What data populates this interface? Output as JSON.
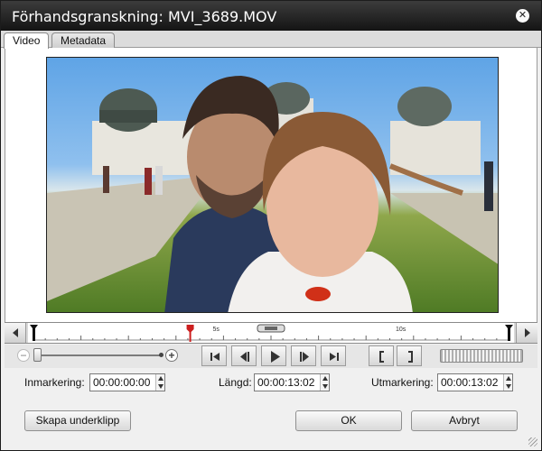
{
  "window": {
    "title": "Förhandsgranskning: MVI_3689.MOV"
  },
  "tabs": [
    {
      "label": "Video",
      "active": true
    },
    {
      "label": "Metadata",
      "active": false
    }
  ],
  "timeline": {
    "ticks": [
      "5s",
      "10s"
    ],
    "playhead_fraction": 0.33
  },
  "zoom": {
    "level_fraction": 0.0
  },
  "fields": {
    "in": {
      "label": "Inmarkering:",
      "value": "00:00:00:00"
    },
    "length": {
      "label": "Längd:",
      "value": "00:00:13:02"
    },
    "out": {
      "label": "Utmarkering:",
      "value": "00:00:13:02"
    }
  },
  "buttons": {
    "create_subclip": "Skapa underklipp",
    "ok": "OK",
    "cancel": "Avbryt"
  },
  "colors": {
    "titlebar": "#1e1e1e",
    "playhead": "#cc1f1f",
    "background": "#f0f0f0"
  }
}
